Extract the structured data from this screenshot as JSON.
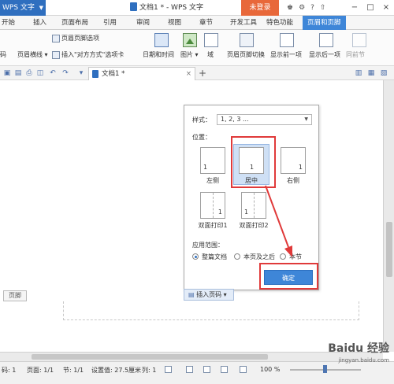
{
  "titlebar": {
    "app_name": "WPS 文字",
    "doc_title": "文档1 * - WPS 文字",
    "login_label": "未登录",
    "buttons": [
      "−",
      "□",
      "×"
    ]
  },
  "menu": {
    "tabs": [
      "开始",
      "插入",
      "页面布局",
      "引用",
      "审阅",
      "视图",
      "章节",
      "开发工具",
      "特色功能",
      "页眉和页脚"
    ],
    "active_tab": "页眉和页脚"
  },
  "ribbon": {
    "page_number": "码",
    "header_footer_options": "页眉页脚选项",
    "header_line": "页眉横线",
    "insert_align_tab": "插入\"对方方式\"选项卡",
    "date_time": "日期和时间",
    "picture": "图片",
    "field": "域",
    "switch_header_footer": "页眉页脚切换",
    "show_previous": "显示前一项",
    "show_next": "显示后一项",
    "same_as_previous": "同前节"
  },
  "doc_tab": {
    "title": "文档1 *",
    "close": "×",
    "add": "+"
  },
  "document": {
    "footer_tag": "页脚"
  },
  "dialog": {
    "style_label": "样式：",
    "style_value": "1, 2, 3 ...",
    "position_label": "位置：",
    "positions": [
      {
        "label": "左侧",
        "number": "1"
      },
      {
        "label": "居中",
        "number": "1"
      },
      {
        "label": "右侧",
        "number": "1"
      },
      {
        "label": "双面打印1",
        "number": "1"
      },
      {
        "label": "双面打印2",
        "number": "1"
      }
    ],
    "selected_position": "居中",
    "scope_label": "应用范围：",
    "scope_options": [
      "整篇文档",
      "本页及之后",
      "本节"
    ],
    "selected_scope": "整篇文档",
    "ok_label": "确定"
  },
  "insert_page_number": "插入页码 ▾",
  "highlight_color": "#e03a3a",
  "statusbar": {
    "page_code": "码: 1",
    "page": "页面: 1/1",
    "section": "节: 1/1",
    "setting": "设置值: 27.5厘米",
    "col": "列: 1",
    "zoom": "100 %"
  },
  "watermark": {
    "brand": "Baidu 经验",
    "url": "jingyan.baidu.com"
  }
}
